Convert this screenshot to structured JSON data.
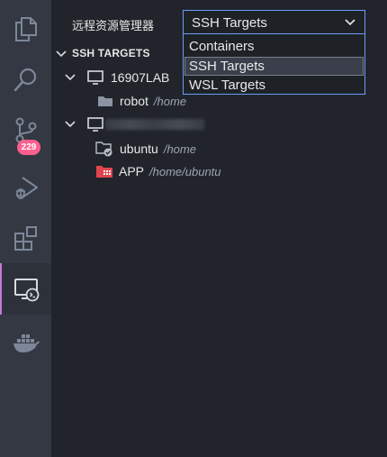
{
  "panel": {
    "title": "远程资源管理器",
    "section_title": "SSH TARGETS"
  },
  "activity_bar": {
    "source_control_badge": "229",
    "active_item": "remote-explorer",
    "accent_color": "#c678dd"
  },
  "target_select": {
    "value": "SSH Targets",
    "options": [
      "Containers",
      "SSH Targets",
      "WSL Targets"
    ],
    "selected_index": 1
  },
  "tree": {
    "host1": {
      "name": "16907LAB",
      "expanded": true
    },
    "host1_folder": {
      "name": "robot",
      "path": "/home"
    },
    "host2": {
      "name": "",
      "expanded": true,
      "name_obscured": true
    },
    "host2_folder1": {
      "name": "ubuntu",
      "path": "/home"
    },
    "host2_folder2": {
      "name": "APP",
      "path": "/home/ubuntu"
    }
  }
}
